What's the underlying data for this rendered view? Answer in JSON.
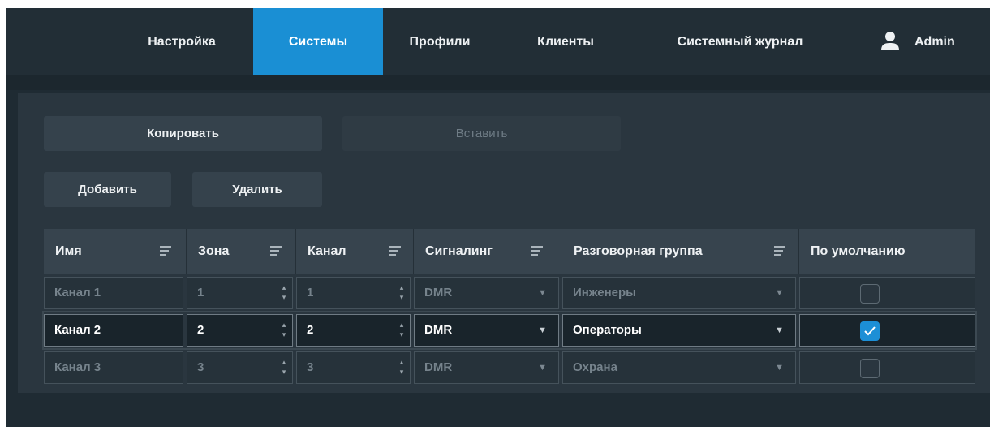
{
  "nav": {
    "items": [
      {
        "label": "Настройка",
        "active": false
      },
      {
        "label": "Системы",
        "active": true
      },
      {
        "label": "Профили",
        "active": false
      },
      {
        "label": "Клиенты",
        "active": false
      },
      {
        "label": "Системный журнал",
        "active": false
      }
    ],
    "user": {
      "name": "Admin",
      "icon": "user-icon"
    }
  },
  "toolbar": {
    "copy_label": "Копировать",
    "paste_label": "Вставить",
    "paste_disabled": true,
    "add_label": "Добавить",
    "delete_label": "Удалить"
  },
  "table": {
    "columns": [
      "Имя",
      "Зона",
      "Канал",
      "Сигналинг",
      "Разговорная группа",
      "По умолчанию"
    ],
    "rows": [
      {
        "name": "Канал 1",
        "zone": "1",
        "channel": "1",
        "signaling": "DMR",
        "talkgroup": "Инженеры",
        "default": false,
        "state": "dim"
      },
      {
        "name": "Канал 2",
        "zone": "2",
        "channel": "2",
        "signaling": "DMR",
        "talkgroup": "Операторы",
        "default": true,
        "state": "active"
      },
      {
        "name": "Канал 3",
        "zone": "3",
        "channel": "3",
        "signaling": "DMR",
        "talkgroup": "Охрана",
        "default": false,
        "state": "dim"
      }
    ]
  },
  "colors": {
    "accent": "#1a8fd4",
    "background": "#1f2b33",
    "panel": "#2a363f",
    "header": "#37444e"
  }
}
